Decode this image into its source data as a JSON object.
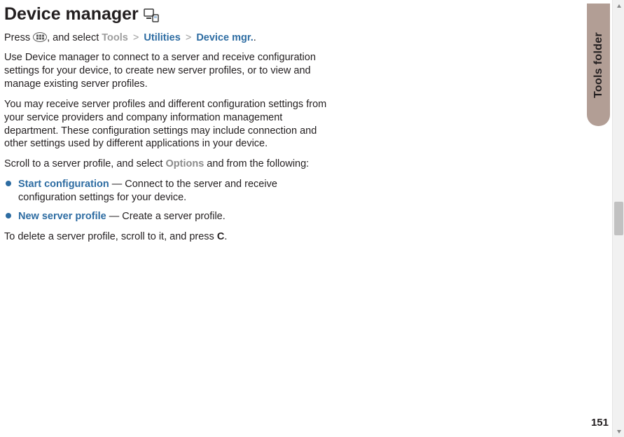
{
  "heading": "Device manager",
  "nav": {
    "prefix": "Press ",
    "after_icon": ", and select ",
    "tools": "Tools",
    "sep": ">",
    "utilities": "Utilities",
    "device_mgr": "Device mgr.",
    "suffix": "."
  },
  "para1": "Use Device manager to connect to a server and receive configuration settings for your device, to create new server profiles, or to view and manage existing server profiles.",
  "para2": "You may receive server profiles and different configuration settings from your service providers and company information management department. These configuration settings may include connection and other settings used by different applications in your device.",
  "para3": {
    "pre": "Scroll to a server profile, and select ",
    "options": "Options",
    "post": " and from the following:"
  },
  "options": [
    {
      "name": "Start configuration",
      "desc": " — Connect to the server and receive configuration settings for your device."
    },
    {
      "name": "New server profile",
      "desc": " — Create a server profile."
    }
  ],
  "para4": {
    "pre": "To delete a server profile, scroll to it, and press ",
    "key": "C",
    "post": "."
  },
  "side_tab": "Tools folder",
  "page_number": "151"
}
